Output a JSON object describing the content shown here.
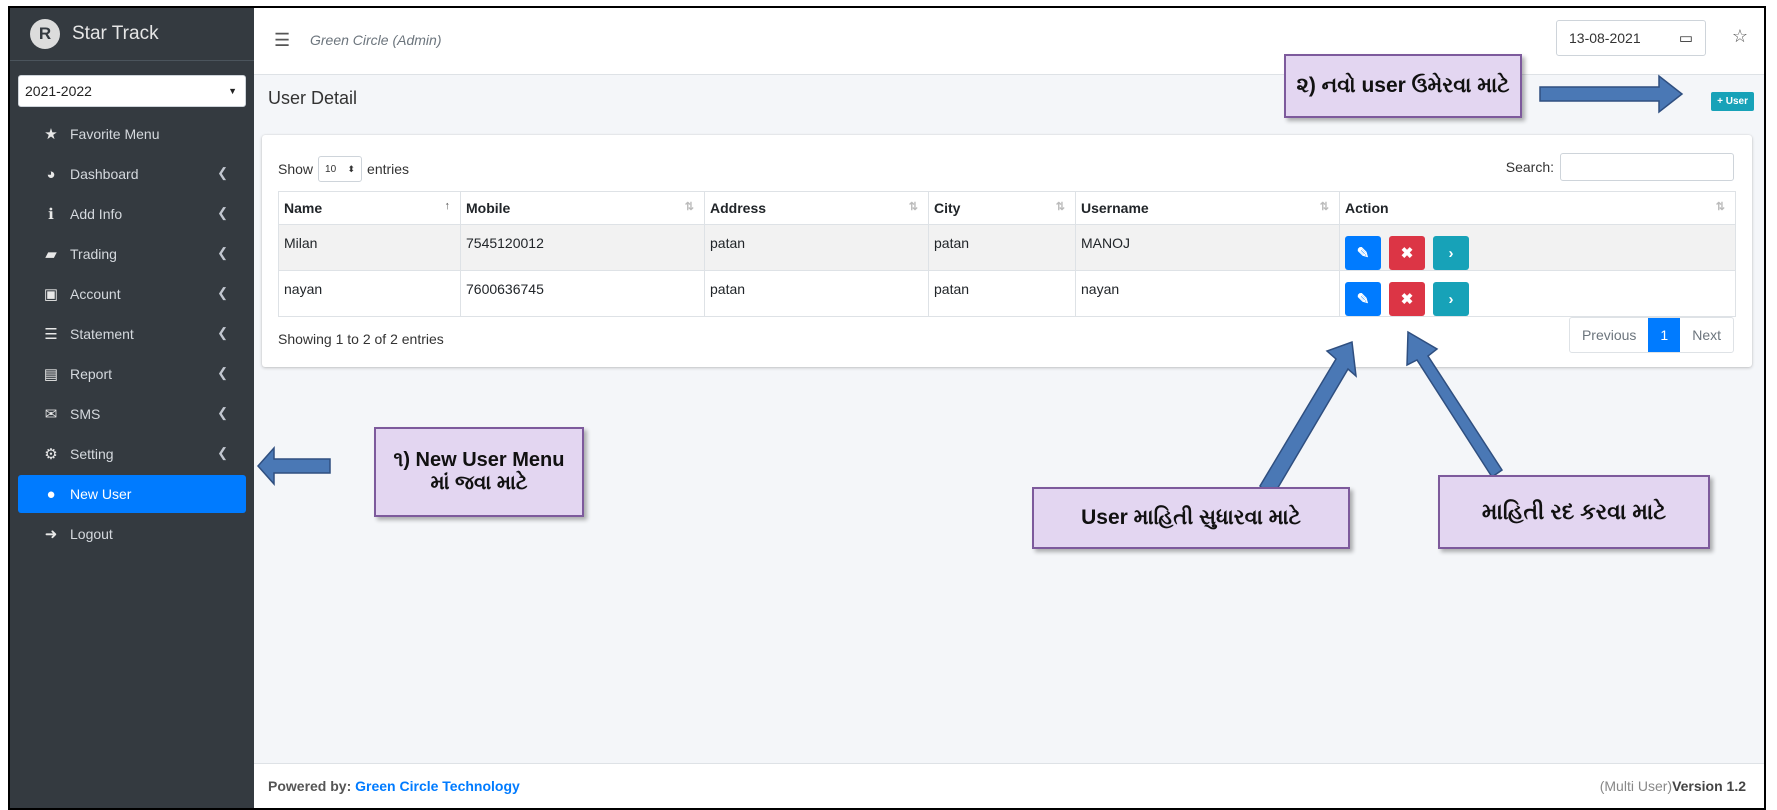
{
  "app": {
    "brand": "Star Track",
    "logo_letter": "R",
    "year": "2021-2022"
  },
  "sidebar": {
    "items": [
      {
        "label": "Favorite Menu",
        "icon": "star-icon",
        "glyph": "★",
        "chevron": false
      },
      {
        "label": "Dashboard",
        "icon": "dashboard-icon",
        "glyph": "◕",
        "chevron": true
      },
      {
        "label": "Add Info",
        "icon": "info-icon",
        "glyph": "ℹ",
        "chevron": true
      },
      {
        "label": "Trading",
        "icon": "briefcase-icon",
        "glyph": "▰",
        "chevron": true
      },
      {
        "label": "Account",
        "icon": "money-icon",
        "glyph": "▣",
        "chevron": true
      },
      {
        "label": "Statement",
        "icon": "list-icon",
        "glyph": "☰",
        "chevron": true
      },
      {
        "label": "Report",
        "icon": "file-icon",
        "glyph": "▤",
        "chevron": true
      },
      {
        "label": "SMS",
        "icon": "envelope-icon",
        "glyph": "✉",
        "chevron": true
      },
      {
        "label": "Setting",
        "icon": "gears-icon",
        "glyph": "⚙",
        "chevron": true
      },
      {
        "label": "New User",
        "icon": "user-circle-icon",
        "glyph": "●",
        "chevron": false,
        "active": true
      },
      {
        "label": "Logout",
        "icon": "logout-icon",
        "glyph": "➜",
        "chevron": false
      }
    ]
  },
  "header": {
    "company": "Green Circle (Admin)",
    "date": "13-08-2021"
  },
  "page": {
    "title": "User Detail",
    "add_button": "+ User"
  },
  "table": {
    "show_label": "Show",
    "length": "10",
    "entries_label": "entries",
    "search_label": "Search:",
    "columns": [
      "Name",
      "Mobile",
      "Address",
      "City",
      "Username",
      "Action"
    ],
    "rows": [
      {
        "name": "Milan",
        "mobile": "7545120012",
        "address": "patan",
        "city": "patan",
        "username": "MANOJ"
      },
      {
        "name": "nayan",
        "mobile": "7600636745",
        "address": "patan",
        "city": "patan",
        "username": "nayan"
      }
    ],
    "info": "Showing 1 to 2 of 2 entries",
    "pager": {
      "prev": "Previous",
      "page": "1",
      "next": "Next"
    }
  },
  "footer": {
    "powered": "Powered by:",
    "company": "Green Circle Technology",
    "edition": "(Multi User)",
    "version": "Version 1.2"
  },
  "callouts": {
    "add_user": "૨) નવો user ઉમેરવા માટે",
    "new_user_menu": "૧) New User Menu માં જવા માટે",
    "edit_info": "User માહિતી સુધારવા માટે",
    "delete_info": "માહિતી રદ કરવા માટે"
  },
  "colors": {
    "sidebar": "#343a40",
    "primary": "#007bff",
    "danger": "#dc3545",
    "info": "#17a2b8",
    "callout_bg": "#e3d6f1",
    "arrow": "#4a78b5"
  }
}
